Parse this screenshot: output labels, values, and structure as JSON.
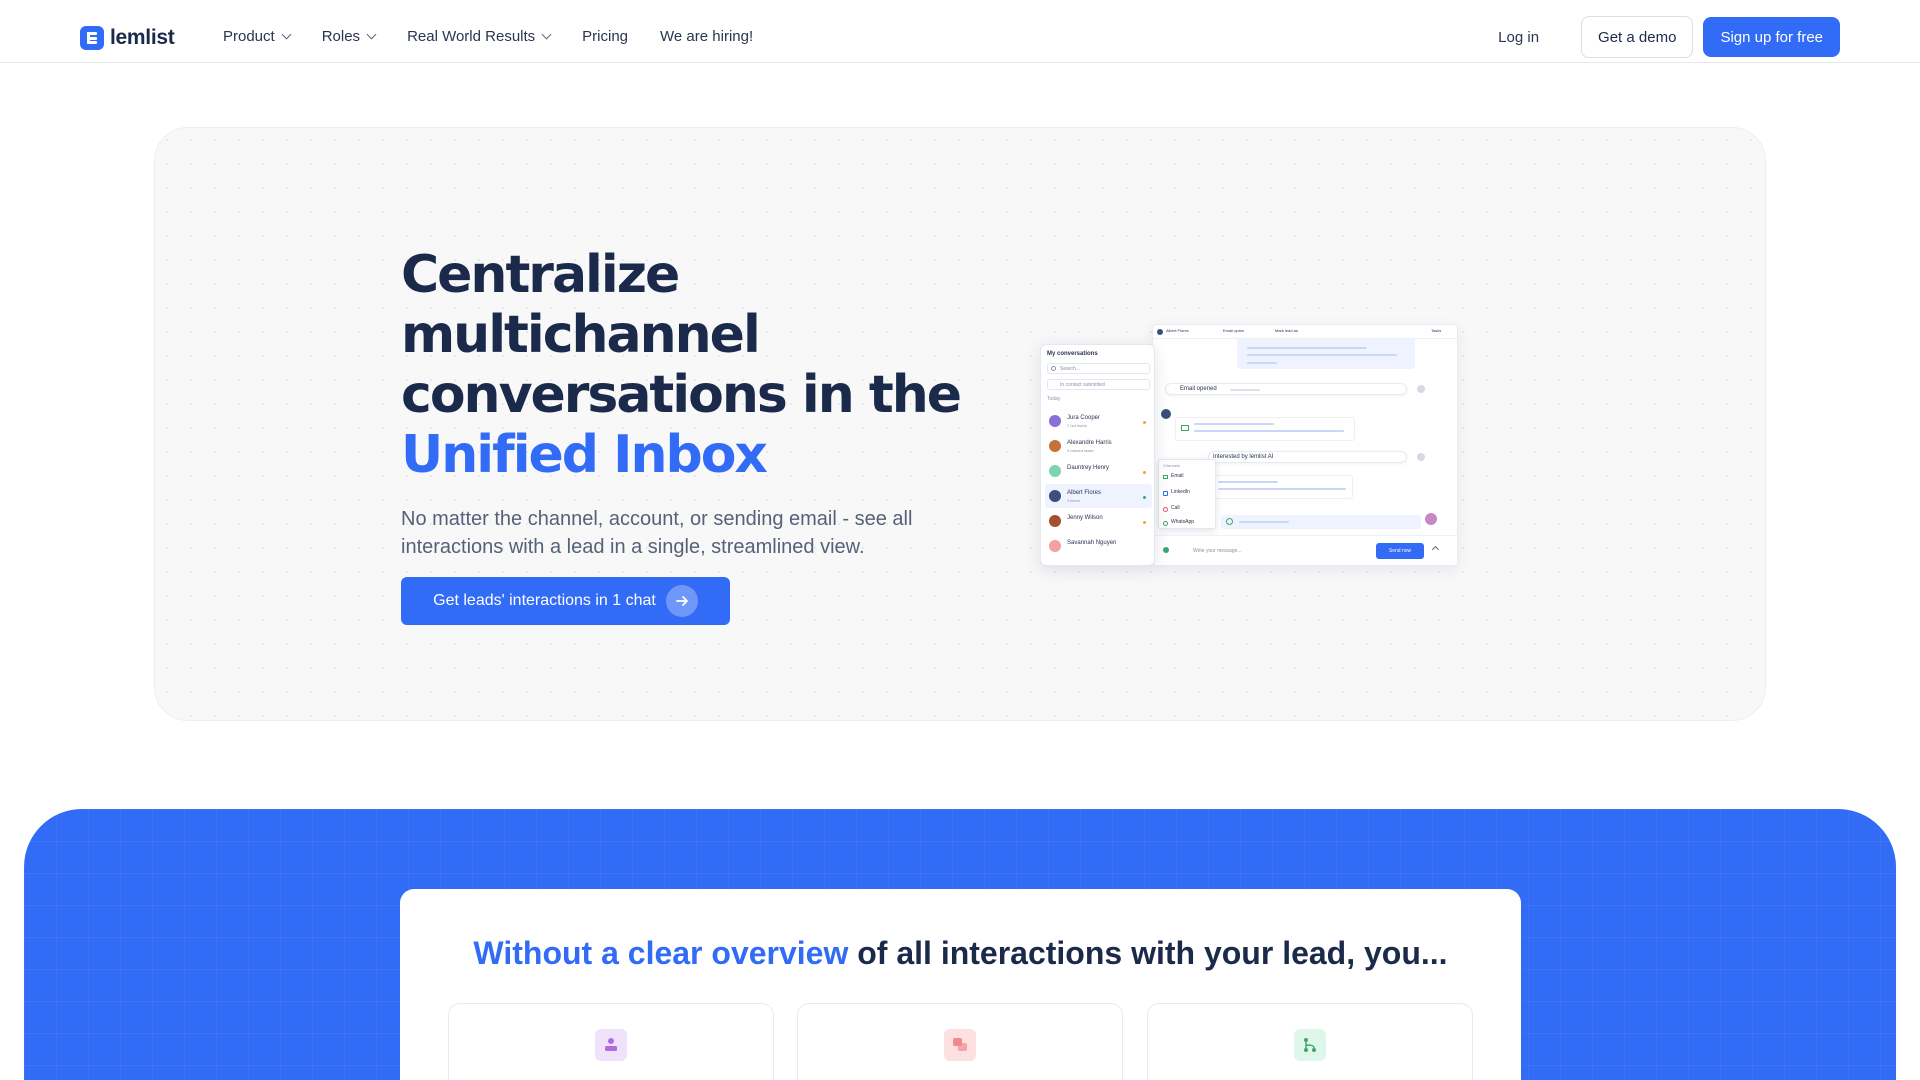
{
  "nav": {
    "logo_text": "lemlist",
    "links": [
      {
        "label": "Product",
        "dropdown": true
      },
      {
        "label": "Roles",
        "dropdown": true
      },
      {
        "label": "Real World Results",
        "dropdown": true
      },
      {
        "label": "Pricing",
        "dropdown": false
      },
      {
        "label": "We are hiring!",
        "dropdown": false
      }
    ],
    "login": "Log in",
    "demo": "Get a demo",
    "signup": "Sign up for free"
  },
  "hero": {
    "title_part1": "Centralize multichannel conversations in the ",
    "title_accent": "Unified Inbox",
    "subtitle": "No matter the channel, account, or sending email - see all interactions with a lead in a single, streamlined view.",
    "cta": "Get leads' interactions in 1 chat"
  },
  "mockup": {
    "sidebar_title": "My conversations",
    "search_placeholder": "Search...",
    "filter": "In contact submitted",
    "section": "Today",
    "contacts": [
      {
        "name": "Jura Cooper",
        "sub": "7 hot leads",
        "color": "#8a6fd6"
      },
      {
        "name": "Alexandre Harris",
        "sub": "3 missed tasks",
        "color": "#c7713a"
      },
      {
        "name": "Dauntrey Henry",
        "sub": "",
        "color": "#7ed3b2"
      },
      {
        "name": "Albert Flores",
        "sub": "3 items",
        "color": "#3a4f7a"
      },
      {
        "name": "Jenny Wilson",
        "sub": "",
        "color": "#a4502e"
      },
      {
        "name": "Savannah Nguyen",
        "sub": "",
        "color": "#f4a0a0"
      }
    ],
    "topbar_name": "Albert Flores",
    "topbar_tab": "Email optos",
    "topbar_mark": "Mark lead as",
    "topbar_tasks": "Tasks",
    "email_opened": "Email opened",
    "interested": "Interested by lemlist AI",
    "channels_label": "Channels",
    "channels": [
      "Email",
      "LinkedIn",
      "Call",
      "WhatsApp"
    ],
    "composer_placeholder": "Write your message...",
    "send": "Send now"
  },
  "problem": {
    "title_accent": "Without a clear overview",
    "title_rest": " of all interactions with your lead, you..."
  },
  "colors": {
    "brand": "#316bf6",
    "text_dark": "#1b2a4a"
  }
}
